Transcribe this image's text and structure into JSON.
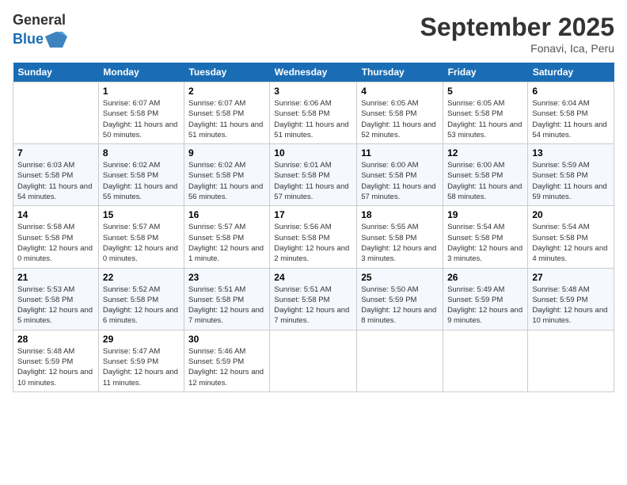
{
  "logo": {
    "general": "General",
    "blue": "Blue"
  },
  "header": {
    "month": "September 2025",
    "location": "Fonavi, Ica, Peru"
  },
  "weekdays": [
    "Sunday",
    "Monday",
    "Tuesday",
    "Wednesday",
    "Thursday",
    "Friday",
    "Saturday"
  ],
  "weeks": [
    [
      {
        "day": "",
        "sunrise": "",
        "sunset": "",
        "daylight": ""
      },
      {
        "day": "1",
        "sunrise": "Sunrise: 6:07 AM",
        "sunset": "Sunset: 5:58 PM",
        "daylight": "Daylight: 11 hours and 50 minutes."
      },
      {
        "day": "2",
        "sunrise": "Sunrise: 6:07 AM",
        "sunset": "Sunset: 5:58 PM",
        "daylight": "Daylight: 11 hours and 51 minutes."
      },
      {
        "day": "3",
        "sunrise": "Sunrise: 6:06 AM",
        "sunset": "Sunset: 5:58 PM",
        "daylight": "Daylight: 11 hours and 51 minutes."
      },
      {
        "day": "4",
        "sunrise": "Sunrise: 6:05 AM",
        "sunset": "Sunset: 5:58 PM",
        "daylight": "Daylight: 11 hours and 52 minutes."
      },
      {
        "day": "5",
        "sunrise": "Sunrise: 6:05 AM",
        "sunset": "Sunset: 5:58 PM",
        "daylight": "Daylight: 11 hours and 53 minutes."
      },
      {
        "day": "6",
        "sunrise": "Sunrise: 6:04 AM",
        "sunset": "Sunset: 5:58 PM",
        "daylight": "Daylight: 11 hours and 54 minutes."
      }
    ],
    [
      {
        "day": "7",
        "sunrise": "Sunrise: 6:03 AM",
        "sunset": "Sunset: 5:58 PM",
        "daylight": "Daylight: 11 hours and 54 minutes."
      },
      {
        "day": "8",
        "sunrise": "Sunrise: 6:02 AM",
        "sunset": "Sunset: 5:58 PM",
        "daylight": "Daylight: 11 hours and 55 minutes."
      },
      {
        "day": "9",
        "sunrise": "Sunrise: 6:02 AM",
        "sunset": "Sunset: 5:58 PM",
        "daylight": "Daylight: 11 hours and 56 minutes."
      },
      {
        "day": "10",
        "sunrise": "Sunrise: 6:01 AM",
        "sunset": "Sunset: 5:58 PM",
        "daylight": "Daylight: 11 hours and 57 minutes."
      },
      {
        "day": "11",
        "sunrise": "Sunrise: 6:00 AM",
        "sunset": "Sunset: 5:58 PM",
        "daylight": "Daylight: 11 hours and 57 minutes."
      },
      {
        "day": "12",
        "sunrise": "Sunrise: 6:00 AM",
        "sunset": "Sunset: 5:58 PM",
        "daylight": "Daylight: 11 hours and 58 minutes."
      },
      {
        "day": "13",
        "sunrise": "Sunrise: 5:59 AM",
        "sunset": "Sunset: 5:58 PM",
        "daylight": "Daylight: 11 hours and 59 minutes."
      }
    ],
    [
      {
        "day": "14",
        "sunrise": "Sunrise: 5:58 AM",
        "sunset": "Sunset: 5:58 PM",
        "daylight": "Daylight: 12 hours and 0 minutes."
      },
      {
        "day": "15",
        "sunrise": "Sunrise: 5:57 AM",
        "sunset": "Sunset: 5:58 PM",
        "daylight": "Daylight: 12 hours and 0 minutes."
      },
      {
        "day": "16",
        "sunrise": "Sunrise: 5:57 AM",
        "sunset": "Sunset: 5:58 PM",
        "daylight": "Daylight: 12 hours and 1 minute."
      },
      {
        "day": "17",
        "sunrise": "Sunrise: 5:56 AM",
        "sunset": "Sunset: 5:58 PM",
        "daylight": "Daylight: 12 hours and 2 minutes."
      },
      {
        "day": "18",
        "sunrise": "Sunrise: 5:55 AM",
        "sunset": "Sunset: 5:58 PM",
        "daylight": "Daylight: 12 hours and 3 minutes."
      },
      {
        "day": "19",
        "sunrise": "Sunrise: 5:54 AM",
        "sunset": "Sunset: 5:58 PM",
        "daylight": "Daylight: 12 hours and 3 minutes."
      },
      {
        "day": "20",
        "sunrise": "Sunrise: 5:54 AM",
        "sunset": "Sunset: 5:58 PM",
        "daylight": "Daylight: 12 hours and 4 minutes."
      }
    ],
    [
      {
        "day": "21",
        "sunrise": "Sunrise: 5:53 AM",
        "sunset": "Sunset: 5:58 PM",
        "daylight": "Daylight: 12 hours and 5 minutes."
      },
      {
        "day": "22",
        "sunrise": "Sunrise: 5:52 AM",
        "sunset": "Sunset: 5:58 PM",
        "daylight": "Daylight: 12 hours and 6 minutes."
      },
      {
        "day": "23",
        "sunrise": "Sunrise: 5:51 AM",
        "sunset": "Sunset: 5:58 PM",
        "daylight": "Daylight: 12 hours and 7 minutes."
      },
      {
        "day": "24",
        "sunrise": "Sunrise: 5:51 AM",
        "sunset": "Sunset: 5:58 PM",
        "daylight": "Daylight: 12 hours and 7 minutes."
      },
      {
        "day": "25",
        "sunrise": "Sunrise: 5:50 AM",
        "sunset": "Sunset: 5:59 PM",
        "daylight": "Daylight: 12 hours and 8 minutes."
      },
      {
        "day": "26",
        "sunrise": "Sunrise: 5:49 AM",
        "sunset": "Sunset: 5:59 PM",
        "daylight": "Daylight: 12 hours and 9 minutes."
      },
      {
        "day": "27",
        "sunrise": "Sunrise: 5:48 AM",
        "sunset": "Sunset: 5:59 PM",
        "daylight": "Daylight: 12 hours and 10 minutes."
      }
    ],
    [
      {
        "day": "28",
        "sunrise": "Sunrise: 5:48 AM",
        "sunset": "Sunset: 5:59 PM",
        "daylight": "Daylight: 12 hours and 10 minutes."
      },
      {
        "day": "29",
        "sunrise": "Sunrise: 5:47 AM",
        "sunset": "Sunset: 5:59 PM",
        "daylight": "Daylight: 12 hours and 11 minutes."
      },
      {
        "day": "30",
        "sunrise": "Sunrise: 5:46 AM",
        "sunset": "Sunset: 5:59 PM",
        "daylight": "Daylight: 12 hours and 12 minutes."
      },
      {
        "day": "",
        "sunrise": "",
        "sunset": "",
        "daylight": ""
      },
      {
        "day": "",
        "sunrise": "",
        "sunset": "",
        "daylight": ""
      },
      {
        "day": "",
        "sunrise": "",
        "sunset": "",
        "daylight": ""
      },
      {
        "day": "",
        "sunrise": "",
        "sunset": "",
        "daylight": ""
      }
    ]
  ]
}
